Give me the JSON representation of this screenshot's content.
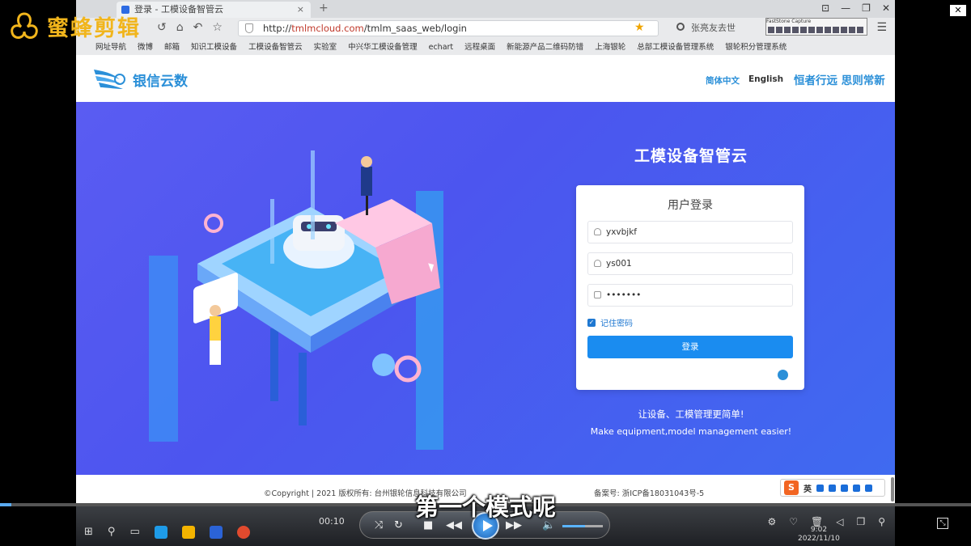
{
  "watermark": {
    "text": "蜜蜂剪辑"
  },
  "browser": {
    "tab_title": "登录 - 工模设备智管云",
    "tab_close": "×",
    "new_tab": "+",
    "address_host": "tmlmcloud.com",
    "address_path": "/tmlm_saas_web/login",
    "address_scheme": "http://",
    "search_text": "张亮友去世",
    "fscapture_title": "FastStone Capture",
    "window_controls": [
      "⊡",
      "—",
      "❐",
      "✕"
    ],
    "nav_icons": [
      "↺",
      "⌂",
      "↶",
      "☆"
    ],
    "bookmarks": [
      "网址导航",
      "微博",
      "邮箱",
      "知识工模设备",
      "工模设备智管云",
      "实验室",
      "中兴华工模设备管理",
      "echart",
      "远程桌面",
      "新能源产品二维码防错",
      "上海银轮",
      "总部工模设备管理系统",
      "银轮积分管理系统"
    ]
  },
  "site": {
    "brand_name": "银信云数",
    "lang_zh": "简体中文",
    "lang_en": "English",
    "slogan": "恒者行远 思则常新"
  },
  "hero": {
    "title": "工模设备智管云",
    "tagline_zh": "让设备、工模管理更简单!",
    "tagline_en": "Make equipment,model management easier!"
  },
  "login": {
    "title": "用户登录",
    "company": "yxvbjkf",
    "username": "ys001",
    "password": "•••••••",
    "remember_label": "记住密码",
    "remember_checked": true,
    "submit_label": "登录"
  },
  "footer": {
    "copyright": "©Copyright | 2021 版权所有: 台州银轮信息科技有限公司",
    "icp": "备案号: 浙ICP备18031043号-5"
  },
  "ime": {
    "logo": "S",
    "mode": "英"
  },
  "player": {
    "subtitle": "第一个模式呢",
    "time": "00:10",
    "progress": 0.012,
    "volume": 0.55
  },
  "taskbar": {
    "clock_time": "9:02",
    "clock_date": "2022/11/10"
  },
  "colors": {
    "accent": "#1a8cf0",
    "brand": "#2a8fd8",
    "hero_bg": "#4c55ef",
    "watermark": "#f1b51c"
  }
}
